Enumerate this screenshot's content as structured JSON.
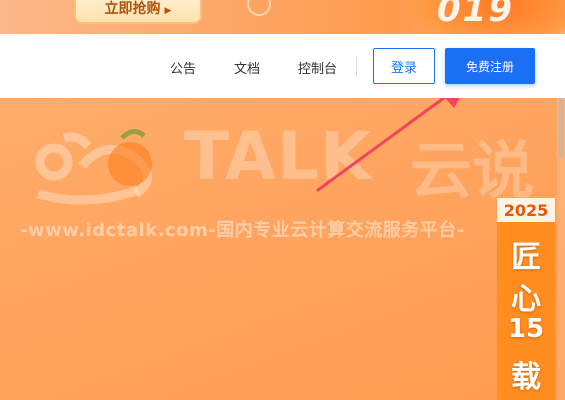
{
  "promo": {
    "button_label": "立即抢购",
    "number": "019"
  },
  "navbar": {
    "links": [
      "公告",
      "文档",
      "控制台"
    ],
    "login_label": "登录",
    "register_label": "免费注册"
  },
  "watermark": {
    "brand": "TALK",
    "brand_cn": "云说",
    "url_text": "-www.idctalk.com-国内专业云计算交流服务平台-"
  },
  "badge": {
    "year": "2025",
    "chars": [
      "匠",
      "心",
      "15",
      "载"
    ]
  },
  "colors": {
    "hero_orange": "#ffa560",
    "primary_blue": "#1b6ff5",
    "arrow_red": "#f2455c"
  }
}
